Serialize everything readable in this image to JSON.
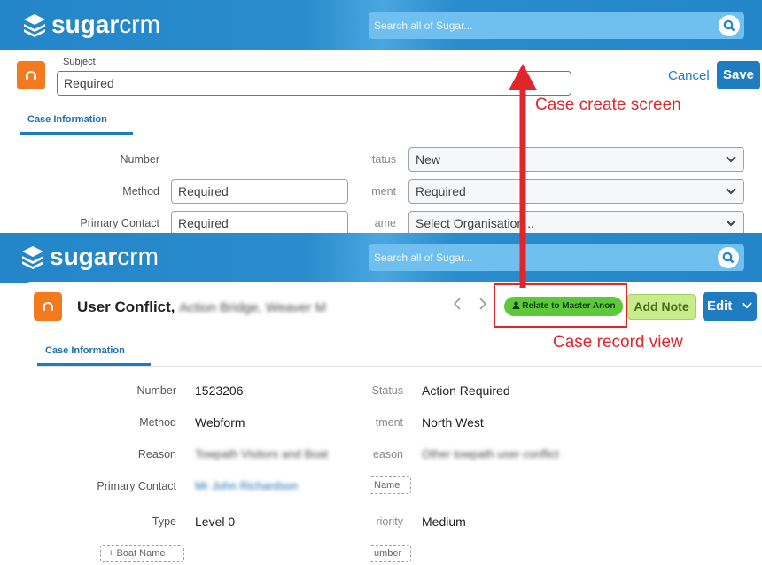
{
  "brand": {
    "name_bold": "sugar",
    "name_light": "crm"
  },
  "create": {
    "search_placeholder": "Search all of Sugar...",
    "subject_label": "Subject",
    "subject_placeholder": "Required",
    "cancel_label": "Cancel",
    "save_label": "Save",
    "tab_label": "Case Information",
    "fields": {
      "number_label": "Number",
      "method_label": "Method",
      "method_placeholder": "Required",
      "primary_contact_label": "Primary Contact",
      "primary_contact_placeholder": "Required",
      "status_label": "tatus",
      "status_value": "New",
      "department_label": "ment",
      "department_value": "Required",
      "organisation_label": "ame",
      "organisation_value": "Select Organisation..."
    }
  },
  "annotations": {
    "create_label": "Case create screen",
    "record_label": "Case record view"
  },
  "record": {
    "search_placeholder": "Search all of Sugar...",
    "title": "User Conflict,",
    "title_blurred": "Action Bridge, Weaver M",
    "relate_label": "Relate to Master Anon",
    "add_note_label": "Add Note",
    "edit_label": "Edit",
    "tab_label": "Case Information",
    "fields": {
      "number_label": "Number",
      "number_value": "1523206",
      "method_label": "Method",
      "method_value": "Webform",
      "reason_label": "Reason",
      "reason_value": "Towpath Visitors and Boat",
      "primary_contact_label": "Primary Contact",
      "primary_contact_value": "Mr John Richardson",
      "type_label": "Type",
      "type_value": "Level 0",
      "boat_name_label": "+ Boat Name",
      "status_label": "Status",
      "status_value": "Action Required",
      "department_label": "tment",
      "department_value": "North West",
      "sub_reason_label": "eason",
      "sub_reason_value": "Other towpath user conflict",
      "name_label": "Name",
      "priority_label": "riority",
      "priority_value": "Medium",
      "number2_label": "umber"
    }
  },
  "colors": {
    "brand_blue": "#2386c9",
    "case_orange": "#f47a20",
    "relate_green": "#5cc83a",
    "add_note_green": "#c6ec8c",
    "annotation_red": "#e0262a"
  }
}
